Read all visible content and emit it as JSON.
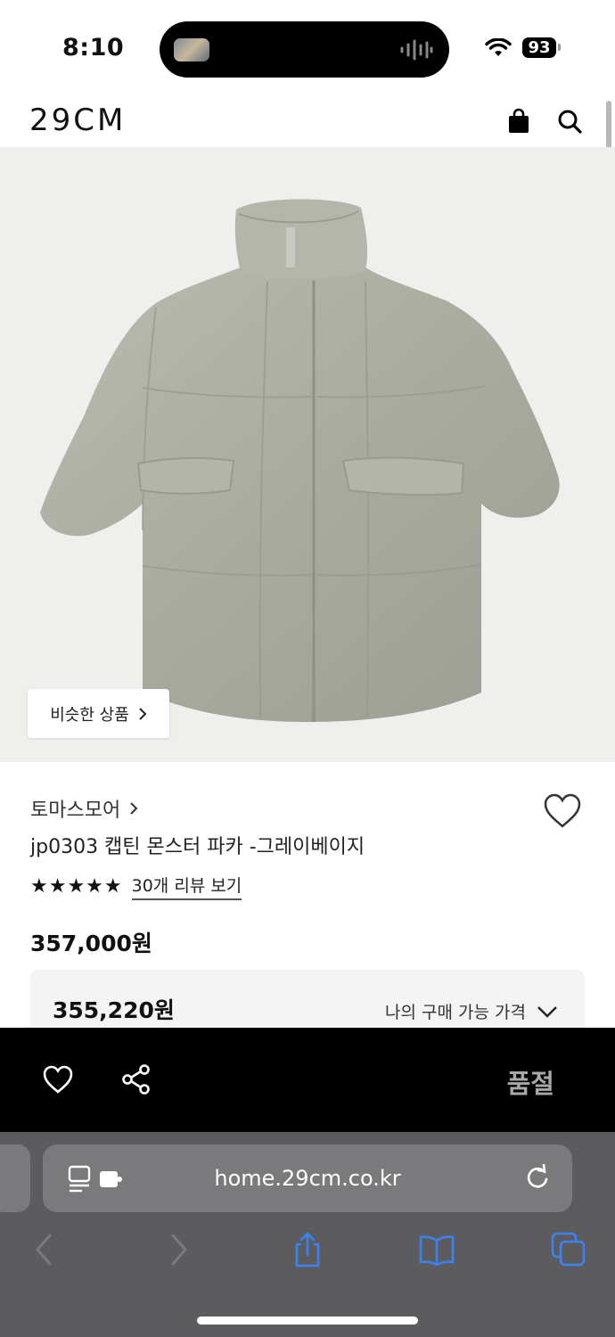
{
  "status_bar": {
    "time": "8:10",
    "battery": "93"
  },
  "header": {
    "logo": "29CM"
  },
  "product": {
    "similar_button_label": "비슷한 상품",
    "brand": "토마스모어",
    "name": "jp0303 캡틴 몬스터 파카 -그레이베이지",
    "rating_stars": "★★★★★",
    "review_link": "30개 리뷰 보기",
    "price": "357,000원",
    "my_price": "355,220원",
    "my_price_label": "나의 구매 가능 가격"
  },
  "action_bar": {
    "soldout_label": "품절"
  },
  "browser": {
    "url": "home.29cm.co.kr"
  },
  "colors": {
    "action_bar_bg": "#000000",
    "toolbar_bg": "#5c5c5e",
    "accent_blue": "#3b82f6"
  }
}
